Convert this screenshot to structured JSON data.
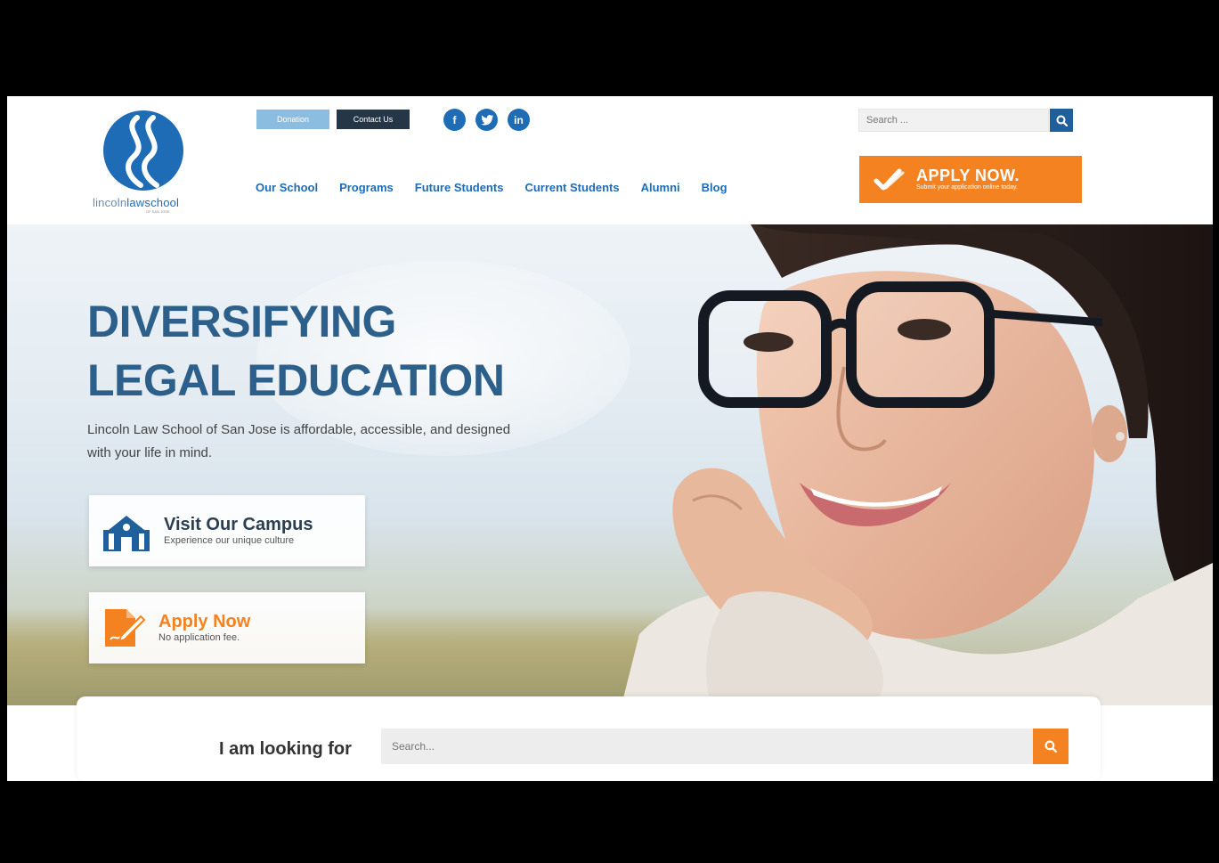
{
  "logo": {
    "text_prefix": "lincoln",
    "text_main": "lawschool",
    "subtext": "OF SAN JOSE"
  },
  "top_buttons": {
    "donation": "Donation",
    "contact": "Contact Us"
  },
  "social": [
    {
      "name": "facebook-icon",
      "glyph": "f"
    },
    {
      "name": "twitter-icon",
      "glyph": "t"
    },
    {
      "name": "linkedin-icon",
      "glyph": "in"
    }
  ],
  "search_top": {
    "placeholder": "Search ..."
  },
  "nav": {
    "items": [
      {
        "label": "Our School"
      },
      {
        "label": "Programs"
      },
      {
        "label": "Future Students"
      },
      {
        "label": "Current Students"
      },
      {
        "label": "Alumni"
      },
      {
        "label": "Blog"
      }
    ]
  },
  "apply_top": {
    "title": "APPLY NOW.",
    "subtitle": "Submit your application online today."
  },
  "hero": {
    "title_line1": "DIVERSIFYING",
    "title_line2": "LEGAL EDUCATION",
    "subtitle": "Lincoln Law School of San Jose is affordable, accessible, and designed with your life in mind."
  },
  "cards": {
    "campus": {
      "title": "Visit Our Campus",
      "subtitle": "Experience our unique culture"
    },
    "apply": {
      "title": "Apply Now",
      "subtitle": "No application fee."
    }
  },
  "bottom_search": {
    "label": "I am looking for",
    "placeholder": "Search..."
  },
  "colors": {
    "brand_blue": "#1e6cb5",
    "orange": "#f58220",
    "navy": "#253647"
  }
}
